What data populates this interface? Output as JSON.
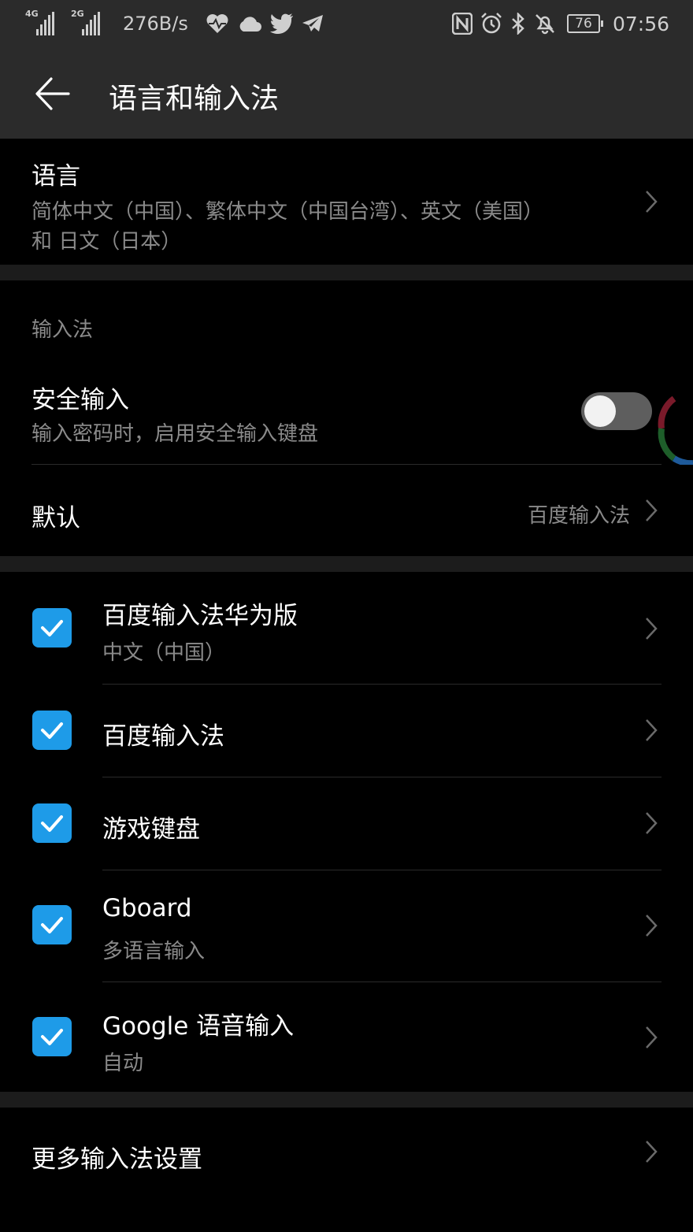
{
  "status_bar": {
    "signal1_tag": "4G",
    "signal2_tag": "2G",
    "net_speed": "276B/s",
    "battery": "76",
    "time": "07:56"
  },
  "app_bar": {
    "title": "语言和输入法"
  },
  "language": {
    "title": "语言",
    "value_line1": "简体中文（中国）、繁体中文（中国台湾）、英文（美国）",
    "value_line2": "和 日文（日本）"
  },
  "input_methods": {
    "section_header": "输入法",
    "secure_input": {
      "title": "安全输入",
      "subtitle": "输入密码时，启用安全输入键盘",
      "enabled": false
    },
    "default": {
      "label": "默认",
      "value": "百度输入法"
    }
  },
  "keyboards": [
    {
      "title": "百度输入法华为版",
      "subtitle": "中文（中国）",
      "checked": true
    },
    {
      "title": "百度输入法",
      "subtitle": "",
      "checked": true
    },
    {
      "title": "游戏键盘",
      "subtitle": "",
      "checked": true
    },
    {
      "title": "Gboard",
      "subtitle": "多语言输入",
      "checked": true
    },
    {
      "title": "Google 语音输入",
      "subtitle": "自动",
      "checked": true
    }
  ],
  "more_settings": {
    "label": "更多输入法设置"
  },
  "colors": {
    "accent": "#1e9be8",
    "background": "#000000",
    "bar": "#2b2b2b",
    "secondary_text": "#8a8a8a"
  }
}
